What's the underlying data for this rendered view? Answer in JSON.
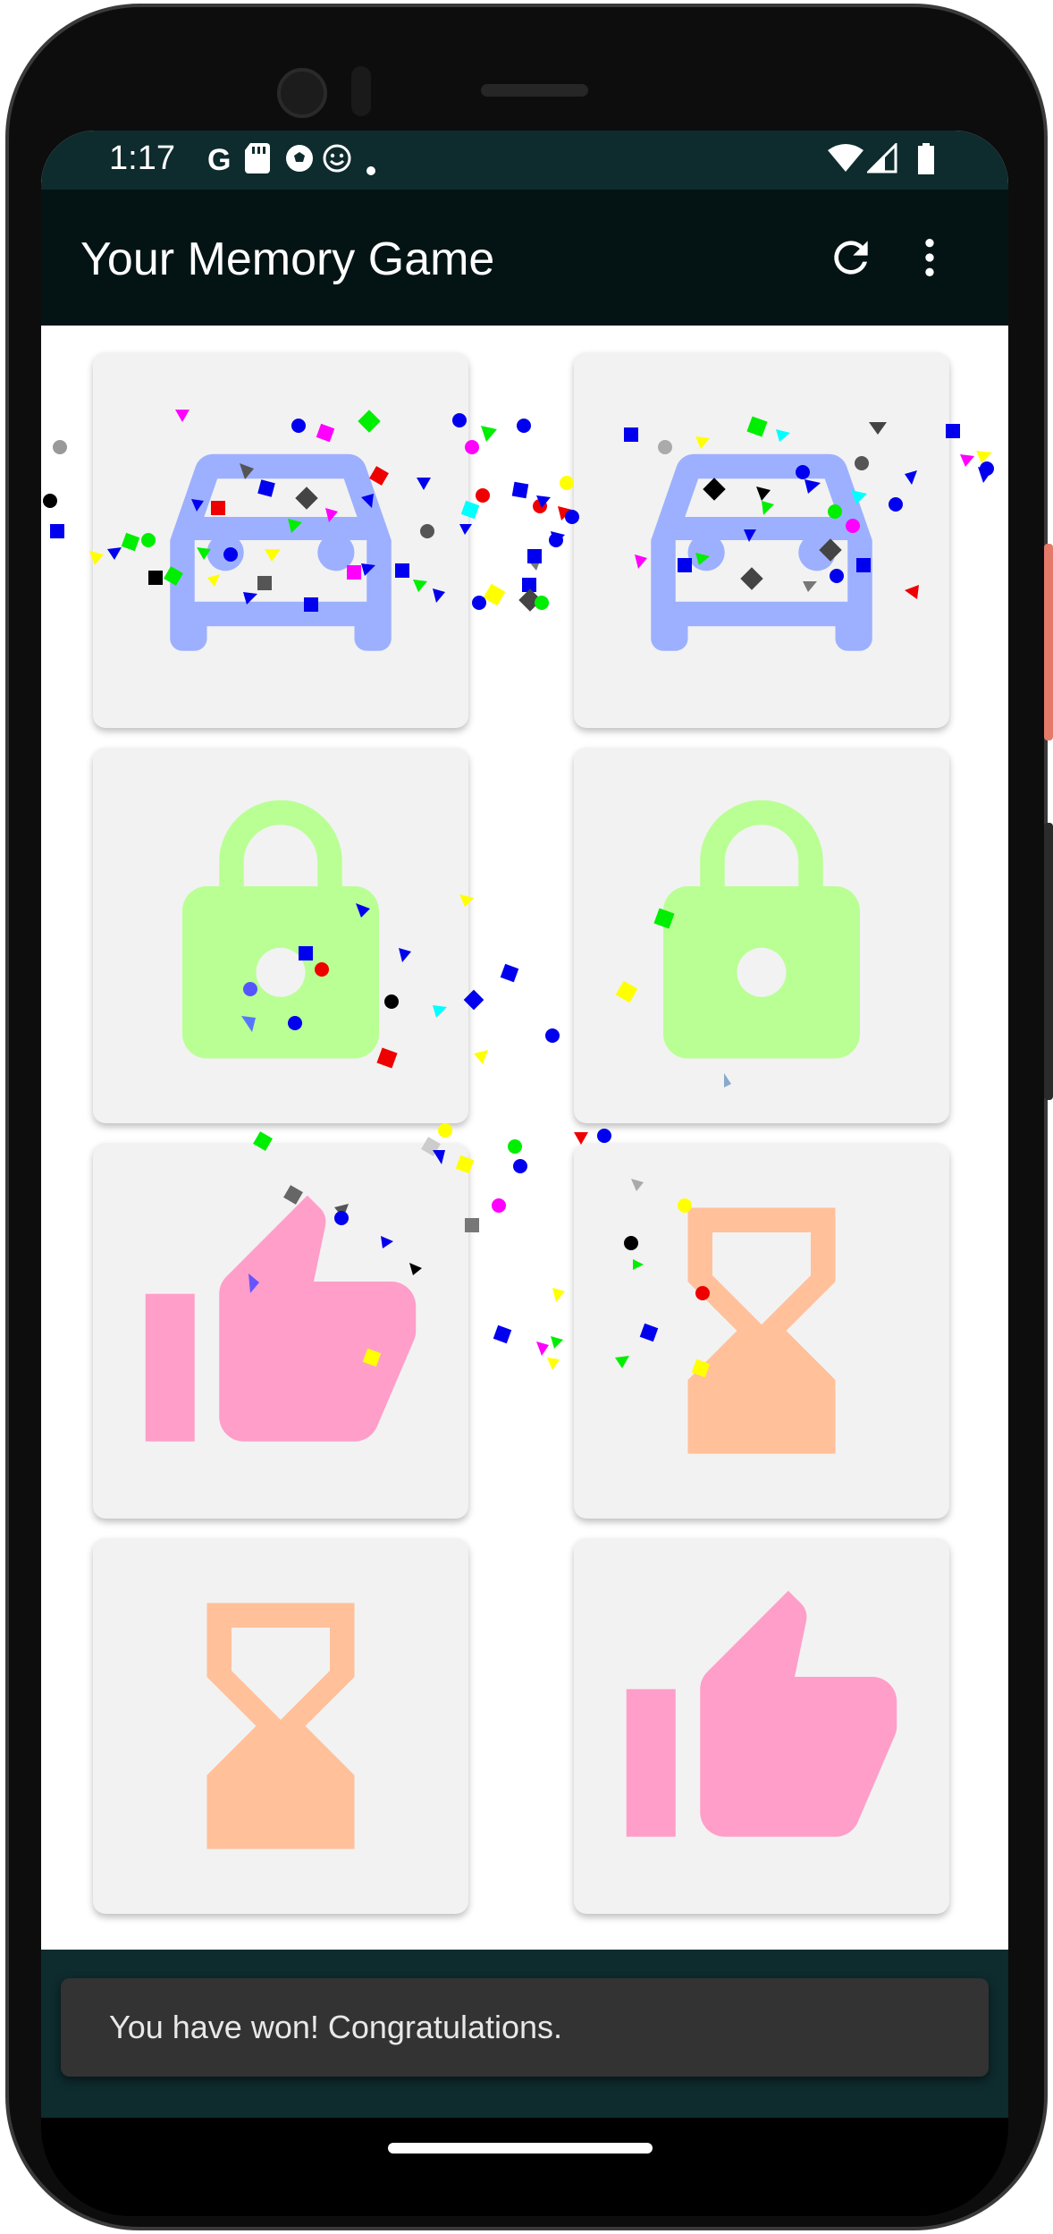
{
  "status_bar": {
    "time": "1:17",
    "left_icons": [
      "google-icon",
      "sd-card-icon",
      "soccer-ball-icon",
      "smiley-icon",
      "dot-icon"
    ],
    "right_icons": [
      "wifi-icon",
      "signal-icon",
      "battery-icon"
    ]
  },
  "app_bar": {
    "title": "Your Memory Game",
    "actions": [
      "refresh-icon",
      "more-vert-icon"
    ]
  },
  "board": {
    "cards": [
      {
        "icon": "car-icon",
        "color": "#9db0ff"
      },
      {
        "icon": "car-icon",
        "color": "#9db0ff"
      },
      {
        "icon": "lock-icon",
        "color": "#b9ff94"
      },
      {
        "icon": "lock-icon",
        "color": "#b9ff94"
      },
      {
        "icon": "thumb-up-icon",
        "color": "#ff9ec9"
      },
      {
        "icon": "hourglass-icon",
        "color": "#ffc09a"
      },
      {
        "icon": "hourglass-icon",
        "color": "#ffc09a"
      },
      {
        "icon": "thumb-up-icon",
        "color": "#ff9ec9"
      }
    ]
  },
  "snackbar": {
    "message": "You have won! Congratulations."
  },
  "colors": {
    "status_bar": "#0e2b2e",
    "app_bar": "#041414",
    "card_bg": "#f2f2f2",
    "snackbar": "#333333"
  }
}
